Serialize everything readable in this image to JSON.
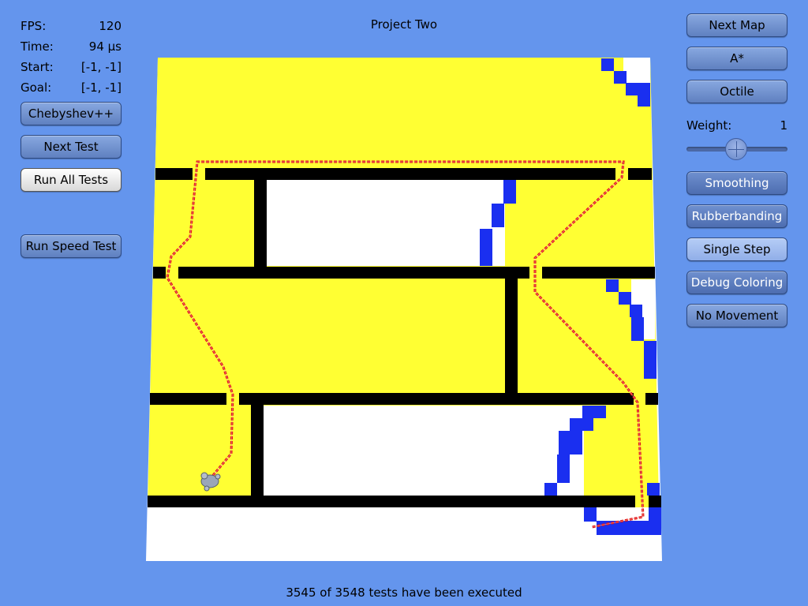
{
  "title": "Project Two",
  "stats": [
    {
      "label": "FPS:",
      "value": "120"
    },
    {
      "label": "Time:",
      "value": "94 µs"
    },
    {
      "label": "Start:",
      "value": "[-1, -1]"
    },
    {
      "label": "Goal:",
      "value": "[-1, -1]"
    }
  ],
  "left_buttons": {
    "heuristic": "Chebyshev++",
    "next_test": "Next Test",
    "run_all_tests": "Run All Tests",
    "run_speed_test": "Run Speed Test"
  },
  "right_panel": {
    "next_map": "Next Map",
    "algorithm": "A*",
    "heuristic": "Octile",
    "weight_label": "Weight:",
    "weight_value": "1",
    "smoothing": "Smoothing",
    "rubberbanding": "Rubberbanding",
    "single_step": "Single Step",
    "debug_coloring": "Debug Coloring",
    "no_movement": "No Movement"
  },
  "status": "3545 of 3548 tests have been executed",
  "colors": {
    "background": "#6495ed",
    "open_cell": "#ffff33",
    "empty_cell": "#ffffff",
    "wall": "#000000",
    "blue_cell": "#1a2ff0",
    "path": "#e01010"
  }
}
